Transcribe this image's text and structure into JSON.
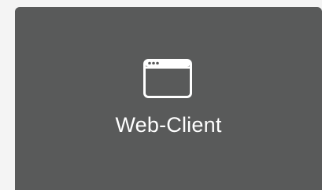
{
  "tile": {
    "label": "Web-Client",
    "icon": "browser-window-icon",
    "background_color": "#595a5a",
    "foreground_color": "#ffffff"
  }
}
